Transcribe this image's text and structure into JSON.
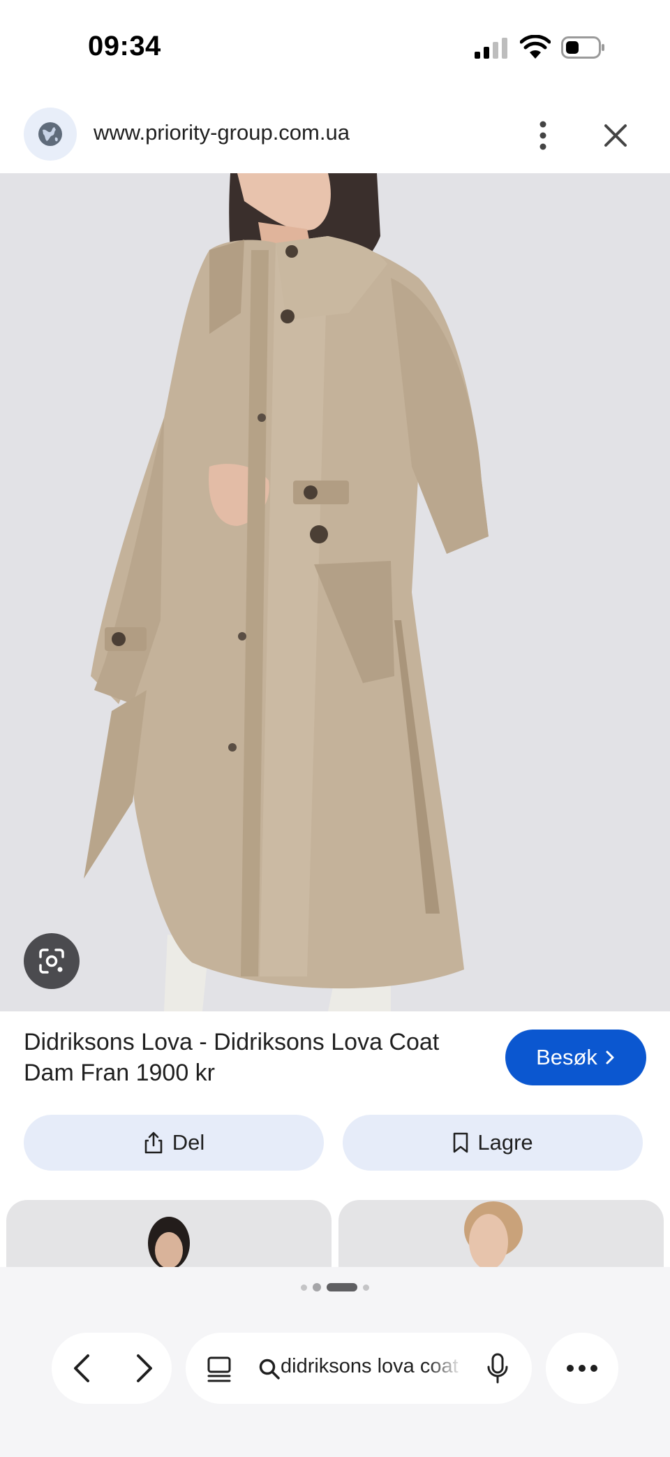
{
  "status_bar": {
    "time": "09:34"
  },
  "url_bar": {
    "url": "www.priority-group.com.ua"
  },
  "product": {
    "title": "Didriksons Lova - Didriksons Lova Coat Dam Fran 1900 kr",
    "visit_label": "Besøk",
    "share_label": "Del",
    "save_label": "Lagre"
  },
  "carousel": {
    "page_count": 4,
    "active_index": 2
  },
  "bottom_bar": {
    "search_query": "didriksons lova coat"
  },
  "icons": [
    "globe-icon",
    "more-vert-icon",
    "close-icon",
    "google-lens-icon",
    "chevron-right-icon",
    "share-icon",
    "bookmark-icon",
    "back-icon",
    "forward-icon",
    "tabs-icon",
    "search-icon",
    "mic-icon",
    "more-horiz-icon"
  ],
  "colors": {
    "accent": "#0b57d0",
    "pill": "#e6ecf9",
    "coat": "#c4b29a",
    "hero_bg": "#e2e2e6"
  }
}
